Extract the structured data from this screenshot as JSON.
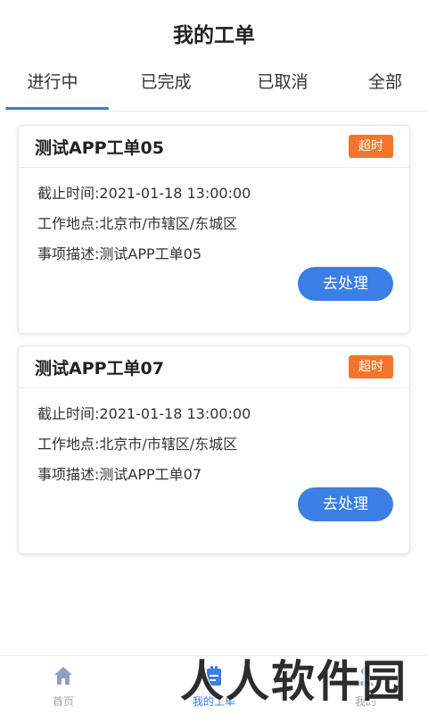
{
  "header": {
    "title": "我的工单"
  },
  "tabs": [
    {
      "label": "进行中",
      "active": true
    },
    {
      "label": "已完成",
      "active": false
    },
    {
      "label": "已取消",
      "active": false
    },
    {
      "label": "全部",
      "active": false
    }
  ],
  "orders": [
    {
      "title": "测试APP工单05",
      "badge": "超时",
      "deadline": "截止时间:2021-01-18 13:00:00",
      "location": "工作地点:北京市/市辖区/东城区",
      "description": "事项描述:测试APP工单05",
      "action_label": "去处理"
    },
    {
      "title": "测试APP工单07",
      "badge": "超时",
      "deadline": "截止时间:2021-01-18 13:00:00",
      "location": "工作地点:北京市/市辖区/东城区",
      "description": "事项描述:测试APP工单07",
      "action_label": "去处理"
    }
  ],
  "bottom_nav": [
    {
      "label": "首页",
      "icon": "home-icon",
      "active": false
    },
    {
      "label": "我的工单",
      "icon": "clipboard-icon",
      "active": true
    },
    {
      "label": "我的",
      "icon": "user-icon",
      "active": false
    }
  ],
  "watermark": "人人软件园",
  "colors": {
    "accent": "#3a7ee6",
    "badge": "#f5742b",
    "inactive_nav": "#9aa4b5"
  }
}
